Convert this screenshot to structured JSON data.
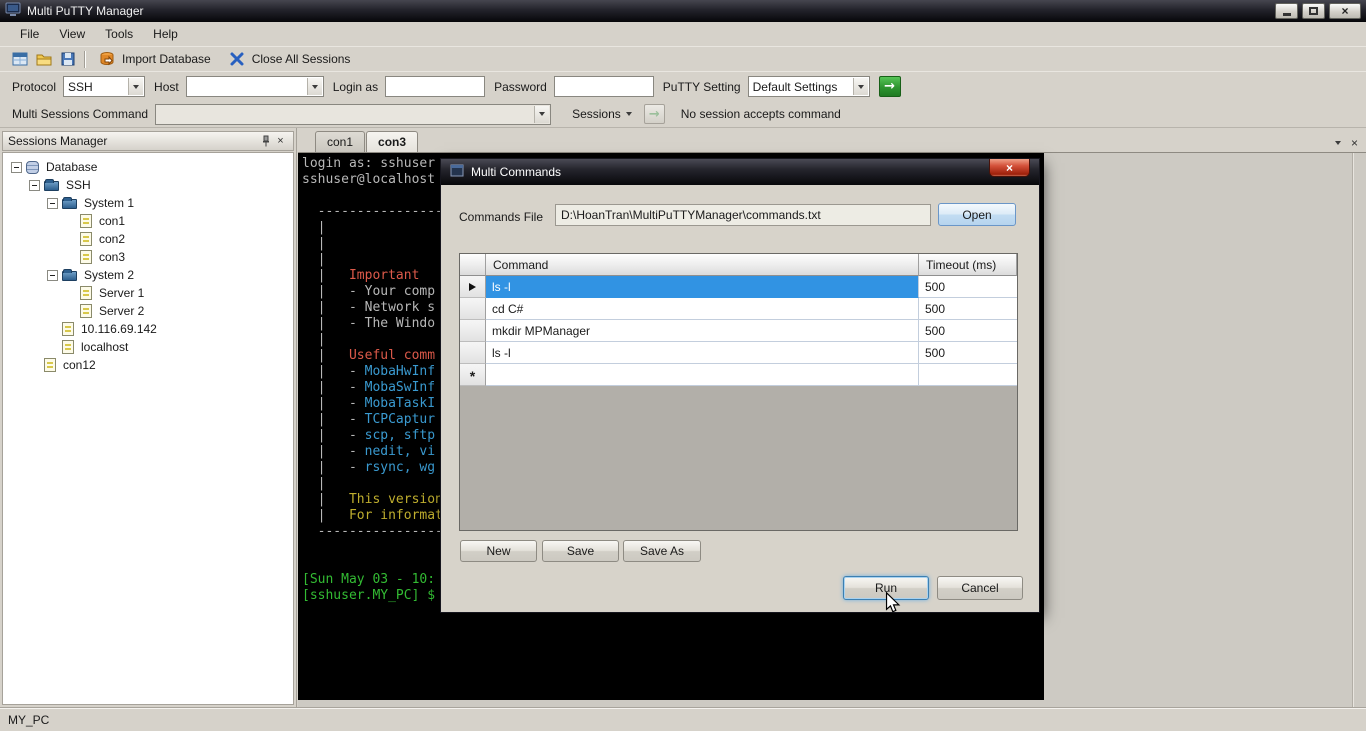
{
  "window": {
    "title": "Multi PuTTY Manager"
  },
  "menu": {
    "items": [
      "File",
      "View",
      "Tools",
      "Help"
    ]
  },
  "toolbar": {
    "import_database": "Import Database",
    "close_all_sessions": "Close All Sessions"
  },
  "connection": {
    "protocol_label": "Protocol",
    "protocol_value": "SSH",
    "host_label": "Host",
    "host_value": "",
    "login_label": "Login as",
    "login_value": "",
    "password_label": "Password",
    "password_value": "",
    "putty_label": "PuTTY Setting",
    "putty_value": "Default Settings"
  },
  "multi_command": {
    "label": "Multi Sessions Command",
    "value": "",
    "sessions_label": "Sessions",
    "status": "No session accepts command"
  },
  "sessions_panel": {
    "title": "Sessions Manager",
    "tree": [
      {
        "label": "Database",
        "level": 0,
        "type": "database",
        "expander": true
      },
      {
        "label": "SSH",
        "level": 1,
        "type": "folder",
        "expander": true
      },
      {
        "label": "System 1",
        "level": 2,
        "type": "folder",
        "expander": true
      },
      {
        "label": "con1",
        "level": 3,
        "type": "session",
        "expander": false
      },
      {
        "label": "con2",
        "level": 3,
        "type": "session",
        "expander": false
      },
      {
        "label": "con3",
        "level": 3,
        "type": "session",
        "expander": false
      },
      {
        "label": "System 2",
        "level": 2,
        "type": "folder",
        "expander": true
      },
      {
        "label": "Server 1",
        "level": 3,
        "type": "session",
        "expander": false
      },
      {
        "label": "Server 2",
        "level": 3,
        "type": "session",
        "expander": false
      },
      {
        "label": "10.116.69.142",
        "level": 2,
        "type": "session",
        "expander": false
      },
      {
        "label": "localhost",
        "level": 2,
        "type": "session",
        "expander": false
      },
      {
        "label": "con12",
        "level": 1,
        "type": "session",
        "expander": false
      }
    ]
  },
  "tabs": [
    {
      "label": "con1",
      "active": false
    },
    {
      "label": "con3",
      "active": true
    }
  ],
  "terminal": {
    "lines": [
      [
        {
          "t": "login as: sshuser",
          "c": "fg"
        }
      ],
      [
        {
          "t": "sshuser@localhost",
          "c": "fg"
        }
      ],
      [],
      [
        {
          "t": "  ----------------------------------------------------------------------",
          "c": "fg"
        }
      ],
      [
        {
          "t": "  |",
          "c": "fg"
        }
      ],
      [
        {
          "t": "  |",
          "c": "fg"
        }
      ],
      [
        {
          "t": "  |",
          "c": "fg"
        }
      ],
      [
        {
          "t": "  |   ",
          "c": "fg"
        },
        {
          "t": "Important",
          "c": "red"
        }
      ],
      [
        {
          "t": "  |   - Your comp",
          "c": "fg"
        }
      ],
      [
        {
          "t": "  |   - Network s",
          "c": "fg"
        }
      ],
      [
        {
          "t": "  |   - The Windo",
          "c": "fg"
        }
      ],
      [
        {
          "t": "  |",
          "c": "fg"
        }
      ],
      [
        {
          "t": "  |   ",
          "c": "fg"
        },
        {
          "t": "Useful comm",
          "c": "red"
        }
      ],
      [
        {
          "t": "  |   - ",
          "c": "fg"
        },
        {
          "t": "MobaHwInf",
          "c": "cyan"
        }
      ],
      [
        {
          "t": "  |   - ",
          "c": "fg"
        },
        {
          "t": "MobaSwInf",
          "c": "cyan"
        }
      ],
      [
        {
          "t": "  |   - ",
          "c": "fg"
        },
        {
          "t": "MobaTaskI",
          "c": "cyan"
        }
      ],
      [
        {
          "t": "  |   - ",
          "c": "fg"
        },
        {
          "t": "TCPCaptur",
          "c": "cyan"
        }
      ],
      [
        {
          "t": "  |   - ",
          "c": "fg"
        },
        {
          "t": "scp, sftp",
          "c": "cyan"
        }
      ],
      [
        {
          "t": "  |   - ",
          "c": "fg"
        },
        {
          "t": "nedit, vi",
          "c": "cyan"
        }
      ],
      [
        {
          "t": "  |   - ",
          "c": "fg"
        },
        {
          "t": "rsync, wg",
          "c": "cyan"
        }
      ],
      [
        {
          "t": "  |",
          "c": "fg"
        }
      ],
      [
        {
          "t": "  |   ",
          "c": "fg"
        },
        {
          "t": "This version",
          "c": "yellow"
        }
      ],
      [
        {
          "t": "  |   ",
          "c": "fg"
        },
        {
          "t": "For informat",
          "c": "yellow"
        }
      ],
      [
        {
          "t": "  ----------------------------------------------------------------------",
          "c": "fg"
        }
      ],
      [],
      [],
      [
        {
          "t": "[Sun May 03 - 10:",
          "c": "green"
        }
      ],
      [
        {
          "t": "[sshuser.MY_PC] $",
          "c": "green"
        }
      ]
    ]
  },
  "dialog": {
    "title": "Multi Commands",
    "file_label": "Commands File",
    "file_value": "D:\\HoanTran\\MultiPuTTYManager\\commands.txt",
    "open_button": "Open",
    "grid": {
      "columns": [
        "Command",
        "Timeout (ms)"
      ],
      "rows": [
        {
          "marker": "current",
          "command": "ls -l",
          "timeout": "500",
          "selected": true
        },
        {
          "marker": "",
          "command": "cd C#",
          "timeout": "500",
          "selected": false
        },
        {
          "marker": "",
          "command": "mkdir MPManager",
          "timeout": "500",
          "selected": false
        },
        {
          "marker": "",
          "command": "ls -l",
          "timeout": "500",
          "selected": false
        },
        {
          "marker": "new",
          "command": "",
          "timeout": "",
          "selected": false
        }
      ]
    },
    "buttons": {
      "new": "New",
      "save": "Save",
      "save_as": "Save As",
      "run": "Run",
      "cancel": "Cancel"
    }
  },
  "statusbar": {
    "text": "MY_PC"
  },
  "icons": {
    "titlebar": [
      "app-icon",
      "minimize-icon",
      "maximize-icon",
      "close-icon"
    ],
    "toolbar": [
      "sessions-manager-icon",
      "open-folder-icon",
      "save-sessions-icon",
      "import-database-icon",
      "close-all-sessions-icon"
    ],
    "panel": [
      "pin-icon",
      "close-icon"
    ],
    "tree": [
      "database-icon",
      "folder-icon",
      "session-icon"
    ],
    "grid": [
      "current-row-marker",
      "new-row-marker"
    ],
    "pointer": [
      "mouse-cursor"
    ]
  }
}
